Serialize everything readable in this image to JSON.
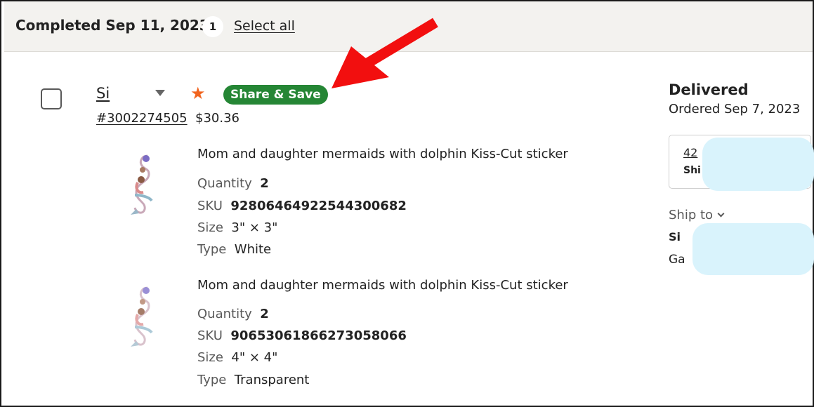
{
  "group": {
    "title": "Completed Sep 11, 2023",
    "count": "1",
    "select_all": "Select all"
  },
  "order": {
    "shop_name": "Si",
    "badge": "Share & Save",
    "star": "★",
    "number": "#3002274505",
    "total": "$30.36",
    "items": [
      {
        "title": "Mom and daughter mermaids with dolphin Kiss-Cut sticker",
        "quantity_label": "Quantity",
        "quantity": "2",
        "sku_label": "SKU",
        "sku": "92806464922544300682",
        "size_label": "Size",
        "size": "3\" × 3\"",
        "type_label": "Type",
        "type": "White"
      },
      {
        "title": "Mom and daughter mermaids with dolphin Kiss-Cut sticker",
        "quantity_label": "Quantity",
        "quantity": "2",
        "sku_label": "SKU",
        "sku": "90653061866273058066",
        "size_label": "Size",
        "size": "4\" × 4\"",
        "type_label": "Type",
        "type": "Transparent"
      }
    ]
  },
  "status": {
    "label": "Delivered",
    "ordered": "Ordered Sep 7, 2023",
    "tracking_number": "42",
    "tracking_sub": "Shi",
    "ship_to_label": "Ship to",
    "address_name": "Si",
    "address_line": "Ga"
  },
  "colors": {
    "header_bg": "#f3f2ef",
    "badge_green": "#258635",
    "star_orange": "#f1641e",
    "redaction": "#d9f3fc"
  },
  "icons": [
    "checkbox-icon",
    "caret-down-icon",
    "star-icon",
    "chevron-down-icon",
    "product-thumbnail"
  ]
}
